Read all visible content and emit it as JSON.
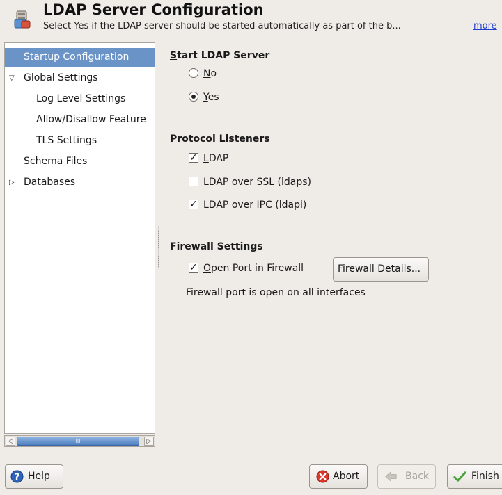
{
  "header": {
    "title": "LDAP Server Configuration",
    "subtitle": "Select Yes if the LDAP server should be started automatically as part of the b...",
    "more_link": "more",
    "icon": "ldap-server-icon"
  },
  "tree": {
    "items": [
      {
        "label": "Startup Configuration",
        "selected": true
      },
      {
        "label": "Global Settings",
        "expanded": true
      },
      {
        "label": "Log Level Settings"
      },
      {
        "label": "Allow/Disallow Feature"
      },
      {
        "label": "TLS Settings"
      },
      {
        "label": "Schema Files"
      },
      {
        "label": "Databases",
        "expanded": false
      }
    ],
    "scrollbar_grip": "III"
  },
  "start_server": {
    "title_prefix": "S",
    "title_rest": "tart LDAP Server",
    "options": [
      {
        "label_prefix": "",
        "mnemonic": "N",
        "label_rest": "o",
        "checked": false
      },
      {
        "label_prefix": "",
        "mnemonic": "Y",
        "label_rest": "es",
        "checked": true
      }
    ]
  },
  "protocol_listeners": {
    "title": "Protocol Listeners",
    "options": [
      {
        "label_prefix": "",
        "mnemonic": "L",
        "label_rest": "DAP",
        "checked": true
      },
      {
        "label_prefix": "LDA",
        "mnemonic": "P",
        "label_rest": " over SSL (ldaps)",
        "checked": false
      },
      {
        "label_prefix": "LDA",
        "mnemonic": "P",
        "label_rest": " over IPC (ldapi)",
        "checked": true
      }
    ]
  },
  "firewall": {
    "title": "Firewall Settings",
    "open_port": {
      "mnemonic": "O",
      "label_rest": "pen Port in Firewall",
      "checked": true
    },
    "details_button": {
      "prefix": "Firewall ",
      "mnemonic": "D",
      "rest": "etails..."
    },
    "status": "Firewall port is open on all interfaces"
  },
  "buttons": {
    "help": "Help",
    "abort": {
      "prefix": "Abo",
      "mnemonic": "r",
      "rest": "t"
    },
    "back": {
      "prefix": "",
      "mnemonic": "B",
      "rest": "ack",
      "disabled": true
    },
    "finish": {
      "prefix": "",
      "mnemonic": "F",
      "rest": "inish"
    }
  },
  "colors": {
    "selection": "#6a93c8",
    "background": "#efebe7",
    "link": "#1f3fd0"
  }
}
